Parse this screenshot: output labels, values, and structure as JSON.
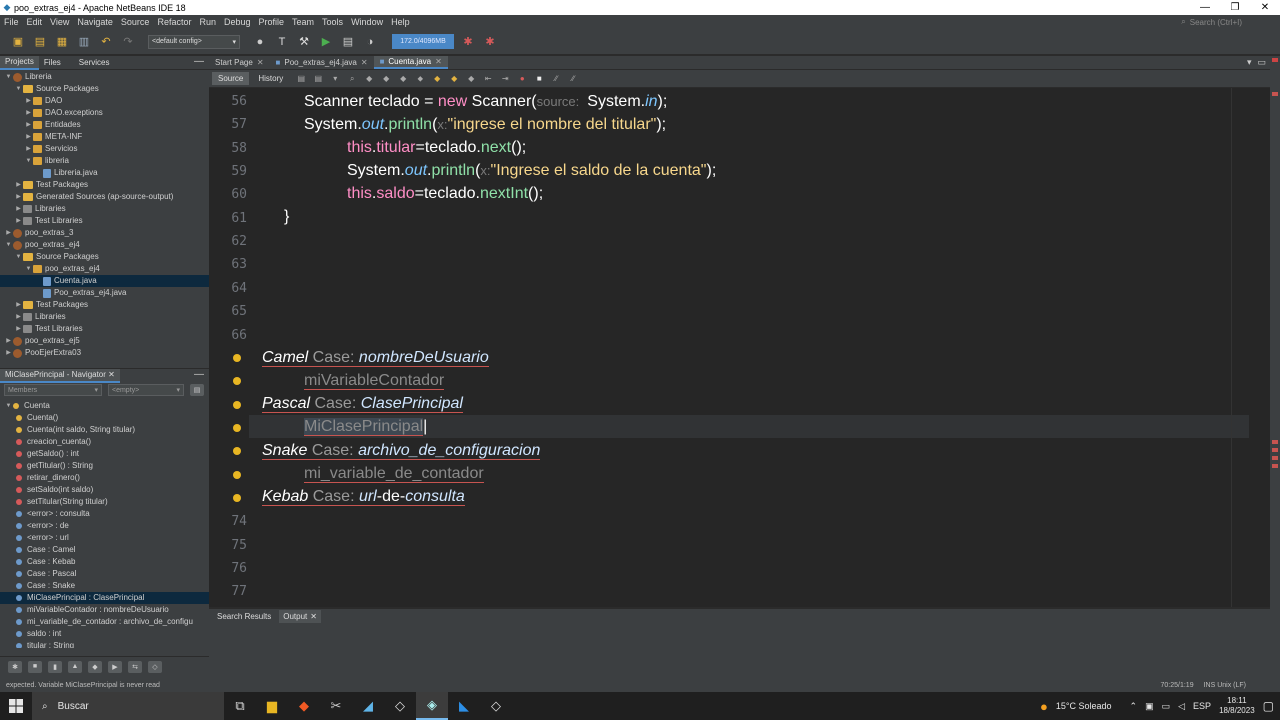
{
  "window": {
    "title": "poo_extras_ej4 - Apache NetBeans IDE 18",
    "min": "—",
    "max": "❐",
    "close": "✕"
  },
  "menu": [
    "File",
    "Edit",
    "View",
    "Navigate",
    "Source",
    "Refactor",
    "Run",
    "Debug",
    "Profile",
    "Team",
    "Tools",
    "Window",
    "Help"
  ],
  "search": {
    "placeholder": "Search (Ctrl+I)"
  },
  "toolbar": {
    "config": "<default config>",
    "memory": "172.0/4096MB"
  },
  "projects_panel": {
    "tabs": [
      "Projects",
      "Files",
      "Services"
    ],
    "tree": [
      {
        "label": "Libreria",
        "indent": 0,
        "icon": "proj",
        "tw": "▼"
      },
      {
        "label": "Source Packages",
        "indent": 1,
        "icon": "fold",
        "tw": "▼"
      },
      {
        "label": "DAO",
        "indent": 2,
        "icon": "pkg",
        "tw": "▶"
      },
      {
        "label": "DAO.exceptions",
        "indent": 2,
        "icon": "pkg",
        "tw": "▶"
      },
      {
        "label": "Entidades",
        "indent": 2,
        "icon": "pkg",
        "tw": "▶"
      },
      {
        "label": "META-INF",
        "indent": 2,
        "icon": "pkg",
        "tw": "▶"
      },
      {
        "label": "Servicios",
        "indent": 2,
        "icon": "pkg",
        "tw": "▶"
      },
      {
        "label": "libreria",
        "indent": 2,
        "icon": "pkg",
        "tw": "▼"
      },
      {
        "label": "Libreria.java",
        "indent": 3,
        "icon": "file",
        "tw": ""
      },
      {
        "label": "Test Packages",
        "indent": 1,
        "icon": "fold",
        "tw": "▶"
      },
      {
        "label": "Generated Sources (ap-source-output)",
        "indent": 1,
        "icon": "fold",
        "tw": "▶"
      },
      {
        "label": "Libraries",
        "indent": 1,
        "icon": "lib",
        "tw": "▶"
      },
      {
        "label": "Test Libraries",
        "indent": 1,
        "icon": "lib",
        "tw": "▶"
      },
      {
        "label": "poo_extras_3",
        "indent": 0,
        "icon": "proj",
        "tw": "▶"
      },
      {
        "label": "poo_extras_ej4",
        "indent": 0,
        "icon": "proj",
        "tw": "▼"
      },
      {
        "label": "Source Packages",
        "indent": 1,
        "icon": "fold",
        "tw": "▼"
      },
      {
        "label": "poo_extras_ej4",
        "indent": 2,
        "icon": "pkg",
        "tw": "▼"
      },
      {
        "label": "Cuenta.java",
        "indent": 3,
        "icon": "file",
        "tw": "",
        "selected": true
      },
      {
        "label": "Poo_extras_ej4.java",
        "indent": 3,
        "icon": "file",
        "tw": ""
      },
      {
        "label": "Test Packages",
        "indent": 1,
        "icon": "fold",
        "tw": "▶"
      },
      {
        "label": "Libraries",
        "indent": 1,
        "icon": "lib",
        "tw": "▶"
      },
      {
        "label": "Test Libraries",
        "indent": 1,
        "icon": "lib",
        "tw": "▶"
      },
      {
        "label": "poo_extras_ej5",
        "indent": 0,
        "icon": "proj",
        "tw": "▶"
      },
      {
        "label": "PooEjerExtra03",
        "indent": 0,
        "icon": "proj",
        "tw": "▶"
      }
    ]
  },
  "navigator": {
    "title": "MiClasePrincipal - Navigator",
    "filter": "Members",
    "filter2": "<empty>",
    "items": [
      {
        "label": "Cuenta",
        "indent": 0,
        "color": "#e3b341",
        "tw": "▼"
      },
      {
        "label": "Cuenta()",
        "indent": 1,
        "color": "#e3b341"
      },
      {
        "label": "Cuenta(int saldo, String titular)",
        "indent": 1,
        "color": "#e3b341"
      },
      {
        "label": "creacion_cuenta()",
        "indent": 1,
        "color": "#d65a5a"
      },
      {
        "label": "getSaldo() : int",
        "indent": 1,
        "color": "#d65a5a"
      },
      {
        "label": "getTitular() : String",
        "indent": 1,
        "color": "#d65a5a"
      },
      {
        "label": "retirar_dinero()",
        "indent": 1,
        "color": "#d65a5a"
      },
      {
        "label": "setSaldo(int saldo)",
        "indent": 1,
        "color": "#d65a5a"
      },
      {
        "label": "setTitular(String titular)",
        "indent": 1,
        "color": "#d65a5a"
      },
      {
        "label": "<error> : consulta",
        "indent": 1,
        "color": "#6d9acb"
      },
      {
        "label": "<error> : de",
        "indent": 1,
        "color": "#6d9acb"
      },
      {
        "label": "<error> : url",
        "indent": 1,
        "color": "#6d9acb"
      },
      {
        "label": "Case : Camel",
        "indent": 1,
        "color": "#6d9acb"
      },
      {
        "label": "Case : Kebab",
        "indent": 1,
        "color": "#6d9acb"
      },
      {
        "label": "Case : Pascal",
        "indent": 1,
        "color": "#6d9acb"
      },
      {
        "label": "Case : Snake",
        "indent": 1,
        "color": "#6d9acb"
      },
      {
        "label": "MiClasePrincipal : ClasePrincipal",
        "indent": 1,
        "color": "#6d9acb",
        "selected": true
      },
      {
        "label": "miVariableContador : nombreDeUsuario",
        "indent": 1,
        "color": "#6d9acb"
      },
      {
        "label": "mi_variable_de_contador : archivo_de_configu",
        "indent": 1,
        "color": "#6d9acb"
      },
      {
        "label": "saldo : int",
        "indent": 1,
        "color": "#6d9acb"
      },
      {
        "label": "titular : String",
        "indent": 1,
        "color": "#6d9acb"
      }
    ]
  },
  "editor": {
    "tabs": [
      {
        "label": "Start Page",
        "active": false
      },
      {
        "label": "Poo_extras_ej4.java",
        "active": false
      },
      {
        "label": "Cuenta.java",
        "active": true
      }
    ],
    "source_label": "Source",
    "history_label": "History",
    "line_numbers": [
      "56",
      "57",
      "58",
      "59",
      "60",
      "61",
      "62",
      "63",
      "64",
      "65",
      "66",
      "",
      "",
      "",
      "",
      "",
      "",
      "",
      "74",
      "75",
      "76",
      "77"
    ],
    "code": {
      "l56": [
        "Scanner teclado = ",
        "new",
        " Scanner(",
        "source: ",
        " System.",
        "in",
        ");"
      ],
      "l57": [
        "System.",
        "out",
        ".",
        "println",
        "(",
        "x:",
        "\"ingrese el nombre del titular\"",
        ");"
      ],
      "l58": [
        "this",
        ".",
        "titular",
        "=teclado.",
        "next",
        "();"
      ],
      "l59": [
        "System.",
        "out",
        ".",
        "println",
        "(",
        "x:",
        "\"Ingrese el saldo de la cuenta\"",
        ");"
      ],
      "l60": [
        "this",
        ".",
        "saldo",
        "=teclado.",
        "nextInt",
        "();"
      ],
      "l61": "}",
      "camel": [
        "Camel",
        " Case: ",
        "nombreDeUsuario"
      ],
      "camel_var": "miVariableContador",
      "pascal": [
        "Pascal",
        " Case: ",
        "ClasePrincipal"
      ],
      "pascal_var": "MiClasePrincipal",
      "snake": [
        "Snake",
        " Case: ",
        "archivo_de_configuracion"
      ],
      "snake_var": "mi_variable_de_contador",
      "kebab": [
        "Kebab",
        " Case: ",
        "url",
        "-de-",
        "consulta"
      ]
    }
  },
  "bottom": {
    "tabs": [
      "Search Results",
      "Output"
    ]
  },
  "status": {
    "message": "expected. Variable MiClasePrincipal is never read",
    "position": "70:25/1:19",
    "mode": "INS Unix (LF)"
  },
  "taskbar": {
    "search": "Buscar",
    "weather": "15°C Soleado",
    "lang": "ESP",
    "time": "18:11",
    "date": "18/8/2023"
  }
}
